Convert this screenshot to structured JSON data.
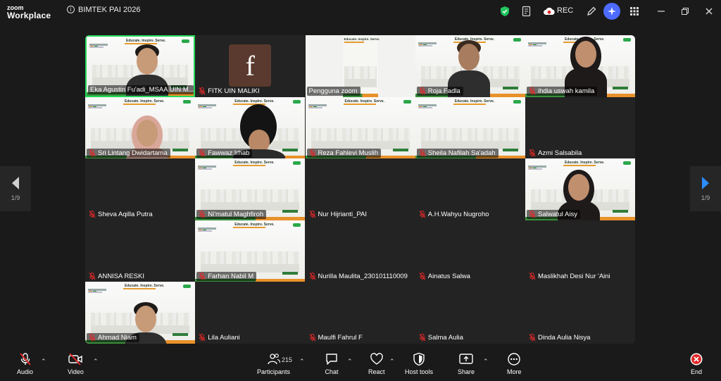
{
  "app": {
    "logo_line1": "zoom",
    "logo_line2": "Workplace",
    "meeting_title": "BIMTEK PAI 2026",
    "rec_label": "REC"
  },
  "nav": {
    "left_page": "1/9",
    "right_page": "1/9"
  },
  "slide": {
    "headline": "Educate. Inspire. Serve."
  },
  "tiles": [
    {
      "name": "Eka Agustin Fu'adi_MSAA UIN M...",
      "video": true,
      "active": true,
      "muted": false
    },
    {
      "name": "FITK UIN MALIKI",
      "video": false,
      "avatar_letter": "f",
      "muted": true
    },
    {
      "name": "Pengguna zoom",
      "video": true,
      "muted": false
    },
    {
      "name": "Roja Fadla",
      "video": true,
      "muted": true
    },
    {
      "name": "ihdia uswah kamila",
      "video": true,
      "muted": true
    },
    {
      "name": "Sri Lintang Dwidartama",
      "video": true,
      "muted": true
    },
    {
      "name": "Fawwaz Irhab",
      "video": true,
      "muted": true
    },
    {
      "name": "Reza Fahlevi Muslih",
      "video": true,
      "muted": true
    },
    {
      "name": "Sheila Nafilah Sa'adah",
      "video": true,
      "muted": true
    },
    {
      "name": "Azmi Salsabila",
      "video": false,
      "muted": true
    },
    {
      "name": "Sheva Aqilla Putra",
      "video": false,
      "muted": true
    },
    {
      "name": "Ni'matul Maghfiroh",
      "video": true,
      "muted": true
    },
    {
      "name": "Nur Hijrianti_PAI",
      "video": false,
      "muted": true
    },
    {
      "name": "A.H.Wahyu Nugroho",
      "video": false,
      "muted": true
    },
    {
      "name": "Salwatul Aisy",
      "video": true,
      "muted": true
    },
    {
      "name": "ANNISA RESKI",
      "video": false,
      "muted": true
    },
    {
      "name": "Farhan Nabil M",
      "video": true,
      "muted": true
    },
    {
      "name": "Nurilla Maulita_230101110009",
      "video": false,
      "muted": true
    },
    {
      "name": "Ainatus Salwa",
      "video": false,
      "muted": true
    },
    {
      "name": "Maslikhah Desi Nur 'Aini",
      "video": false,
      "muted": true
    },
    {
      "name": "Ahmad Niam",
      "video": true,
      "muted": true
    },
    {
      "name": "Lila Auliani",
      "video": false,
      "muted": true
    },
    {
      "name": "Maulfi Fahrul F",
      "video": false,
      "muted": true
    },
    {
      "name": "Salma Aulia",
      "video": false,
      "muted": true
    },
    {
      "name": "Dinda Aulia Nisya",
      "video": false,
      "muted": true
    }
  ],
  "toolbar": {
    "audio": "Audio",
    "video": "Video",
    "participants": "Participants",
    "participants_count": "215",
    "chat": "Chat",
    "react": "React",
    "host_tools": "Host tools",
    "share": "Share",
    "more": "More",
    "end": "End"
  },
  "colors": {
    "active_speaker": "#23d959",
    "muted_red": "#e02828",
    "end_red": "#e02828",
    "ai_blue": "#4d6bff",
    "shield_green": "#22c55e"
  }
}
